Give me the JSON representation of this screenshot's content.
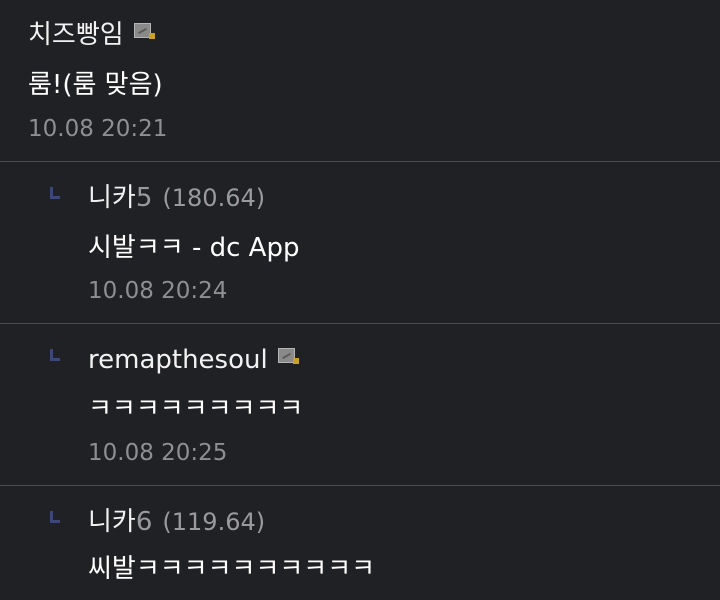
{
  "comments": [
    {
      "name": "치즈빵임",
      "name_suffix": "",
      "ip": "",
      "has_badge": true,
      "text": "룸!(룸 맞음)",
      "time": "10.08 20:21"
    },
    {
      "name": "니카",
      "name_suffix": "5",
      "ip": "(180.64)",
      "has_badge": false,
      "text": "시발ㅋㅋ - dc App",
      "time": "10.08 20:24"
    },
    {
      "name": "remapthesoul",
      "name_suffix": "",
      "ip": "",
      "has_badge": true,
      "text": "ㅋㅋㅋㅋㅋㅋㅋㅋㅋ",
      "time": "10.08 20:25"
    },
    {
      "name": "니카",
      "name_suffix": "6",
      "ip": "(119.64)",
      "has_badge": false,
      "text": "씨발ㅋㅋㅋㅋㅋㅋㅋㅋㅋㅋ",
      "time": ""
    }
  ],
  "icons": {
    "gallog_badge": "gallog-icon",
    "reply_marker": "reply-arrow-icon"
  },
  "colors": {
    "background": "#202124",
    "divider": "#4a4b4f",
    "meta_text": "#8e8e93",
    "reply_marker": "#3d4778",
    "badge_accent": "#c9a227"
  }
}
